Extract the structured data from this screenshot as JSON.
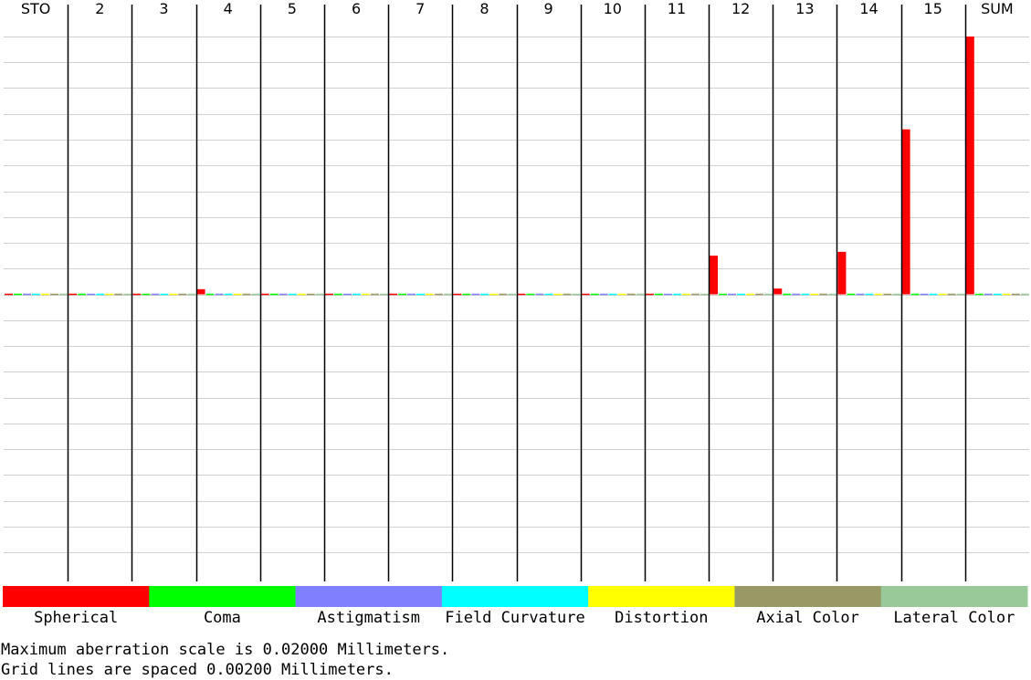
{
  "chart_data": {
    "type": "bar",
    "categories": [
      "STO",
      "2",
      "3",
      "4",
      "5",
      "6",
      "7",
      "8",
      "9",
      "10",
      "11",
      "12",
      "13",
      "14",
      "15",
      "SUM"
    ],
    "series": [
      {
        "name": "Spherical",
        "color": "#ff0000",
        "values": [
          2e-05,
          0.0001,
          5e-05,
          0.0004,
          2e-05,
          1e-05,
          1e-05,
          1e-05,
          1e-05,
          1e-05,
          1e-05,
          0.003,
          0.00045,
          0.0033,
          0.0128,
          0.02
        ]
      },
      {
        "name": "Coma",
        "color": "#00ff00",
        "values": [
          0,
          0,
          0,
          0,
          0,
          0,
          0,
          0,
          0,
          0,
          0,
          0,
          0,
          0,
          0,
          0
        ]
      },
      {
        "name": "Astigmatism",
        "color": "#8080ff",
        "values": [
          0,
          0,
          0,
          0,
          0,
          0,
          0,
          0,
          0,
          0,
          0,
          0,
          0,
          0,
          0,
          0
        ]
      },
      {
        "name": "Field Curvature",
        "color": "#00ffff",
        "values": [
          0,
          0,
          0,
          0,
          0,
          0,
          0,
          0,
          0,
          0,
          0,
          0,
          0,
          0,
          0,
          0
        ]
      },
      {
        "name": "Distortion",
        "color": "#ffff00",
        "values": [
          0,
          0,
          0,
          0,
          0,
          0,
          0,
          0,
          0,
          0,
          0,
          0,
          0,
          0,
          0,
          0
        ]
      },
      {
        "name": "Axial Color",
        "color": "#999966",
        "values": [
          0,
          0,
          0,
          0,
          0,
          0,
          0,
          0,
          0,
          0,
          0,
          0,
          0,
          0,
          0,
          0
        ]
      },
      {
        "name": "Lateral Color",
        "color": "#99c899",
        "values": [
          0,
          0,
          0,
          0,
          0,
          0,
          0,
          0,
          0,
          0,
          0,
          0,
          0,
          0,
          0,
          0
        ]
      }
    ],
    "ylim": [
      -0.02,
      0.02
    ],
    "grid_spacing": 0.002,
    "grid": true,
    "legend_position": "bottom"
  },
  "footer": {
    "line1": "Maximum aberration scale is 0.02000 Millimeters.",
    "line2": "Grid lines are spaced 0.00200 Millimeters."
  }
}
